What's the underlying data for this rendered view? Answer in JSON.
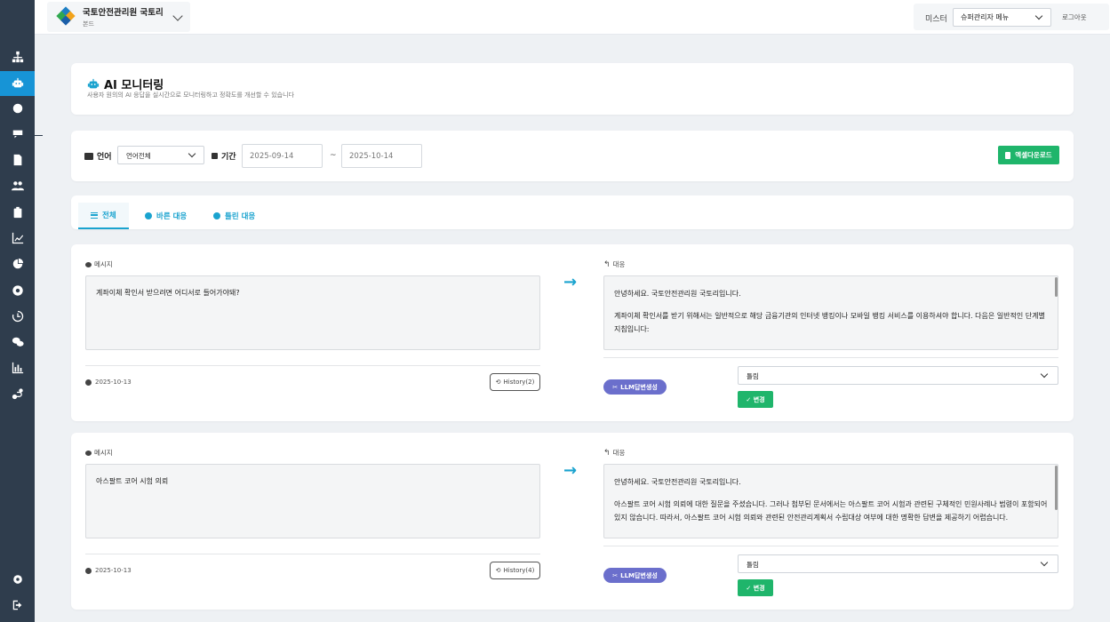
{
  "header": {
    "org_name": "국토안전관리원 국토리",
    "org_sub": "본드",
    "master_label": "미스터",
    "role_value": "슈퍼관리자 메뉴",
    "logout_label": "로그아웃"
  },
  "sidebar": {
    "items": [
      {
        "icon": "sitemap-icon"
      },
      {
        "icon": "robot-icon",
        "active": true
      },
      {
        "icon": "brain-icon"
      },
      {
        "icon": "chat-icon"
      },
      {
        "icon": "file-icon"
      },
      {
        "icon": "users-icon"
      },
      {
        "icon": "clipboard-icon"
      },
      {
        "icon": "line-chart-icon"
      },
      {
        "icon": "pie-chart-icon"
      },
      {
        "icon": "target-icon"
      },
      {
        "icon": "history-icon"
      },
      {
        "icon": "comments-icon"
      },
      {
        "icon": "bar-chart-icon"
      },
      {
        "icon": "route-icon"
      }
    ],
    "bottom": [
      {
        "icon": "gear-icon"
      },
      {
        "icon": "sign-out-icon"
      }
    ]
  },
  "page": {
    "title": "AI 모니터링",
    "subtitle": "사용자 원의의 AI 응답을 실시간으로 모니터링하고 정확도를 개선할 수 있습니다"
  },
  "filters": {
    "language_label": "언어",
    "language_value": "언어전체",
    "period_label": "기간",
    "start_date": "2025-09-14",
    "end_date": "2025-10-14",
    "tilde": "~",
    "excel_label": "엑셀다운로드"
  },
  "tabs": [
    {
      "label": "전체",
      "active": true
    },
    {
      "label": "바른 대응"
    },
    {
      "label": "틀린 대응"
    }
  ],
  "messages": [
    {
      "message_label": "메시지",
      "message_text": "계좌이체 확인서 받으려면 어디서로 들어가야돼?",
      "response_label": "대응",
      "response_lines": [
        "안녕하세요. 국토안전관리원 국토리입니다.",
        "계좌이체 확인서를 받기 위해서는 일반적으로 해당 금융기관의 인터넷 뱅킹이나 모바일 뱅킹 서비스를 이용하셔야 합니다. 다음은 일반적인 단계별 지침입니다:"
      ],
      "date": "2025-10-13",
      "history_label": "History(2)",
      "llm_label": "LLM답변생성",
      "judge_value": "틀림",
      "change_label": "✓ 변경"
    },
    {
      "message_label": "메시지",
      "message_text": "아스팔트 코어 시험 의뢰",
      "response_label": "대응",
      "response_lines": [
        "안녕하세요. 국토안전관리원 국토리입니다.",
        "아스팔트 코어 시험 의뢰에 대한 질문을 주셨습니다. 그러나 첨부된 문서에서는 아스팔트 코어 시험과 관련된 구체적인 민원사례나 범령이 포함되어 있지 않습니다. 따라서, 아스팔트 코어 시험 의뢰와 관련된 안전관리계획서 수립대상 여부에 대한 명확한 답변을 제공하기 어렵습니다."
      ],
      "date": "2025-10-13",
      "history_label": "History(4)",
      "llm_label": "LLM답변생성",
      "judge_value": "틀림",
      "change_label": "✓ 변경"
    }
  ],
  "colors": {
    "accent": "#1aa3cf",
    "sidebar": "#2f3d4d",
    "green": "#1fb56b",
    "purple": "#6b6fcc"
  }
}
